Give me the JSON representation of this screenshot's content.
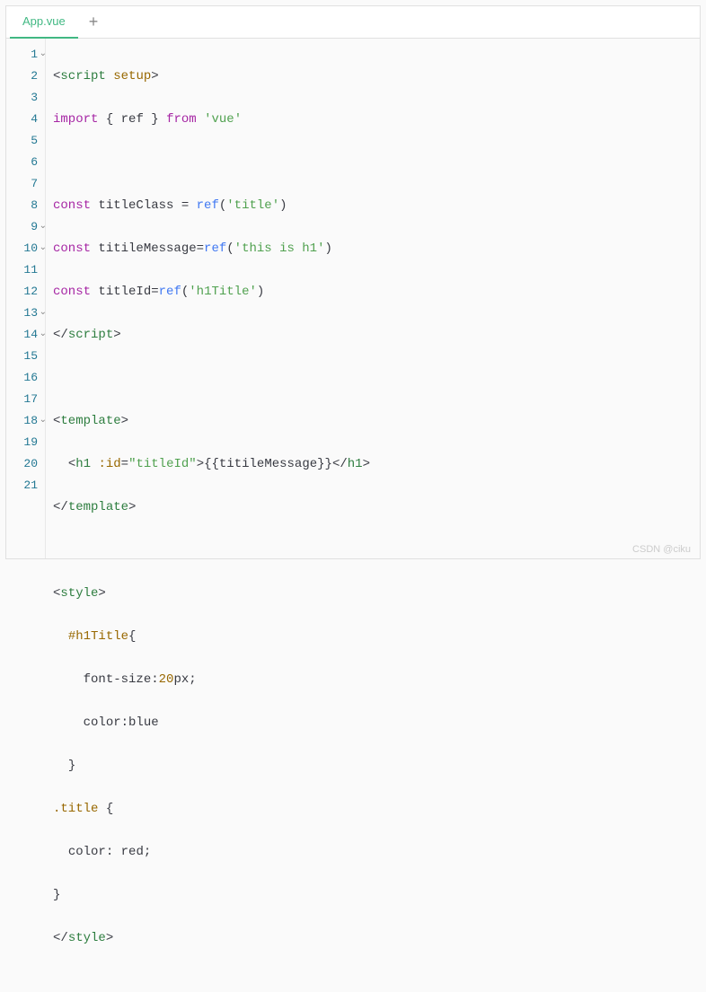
{
  "tabs": {
    "active": "App.vue",
    "add_icon": "+"
  },
  "gutter": {
    "lines": [
      "1",
      "2",
      "3",
      "4",
      "5",
      "6",
      "7",
      "8",
      "9",
      "10",
      "11",
      "12",
      "13",
      "14",
      "15",
      "16",
      "17",
      "18",
      "19",
      "20",
      "21"
    ],
    "foldable": [
      1,
      9,
      10,
      13,
      14,
      18
    ]
  },
  "code": {
    "l1": {
      "open": "<",
      "tag": "script",
      "sp": " ",
      "attr": "setup",
      "close": ">"
    },
    "l2": {
      "kw": "import",
      "sp1": " ",
      "b1": "{ ",
      "id": "ref",
      "b2": " }",
      "sp2": " ",
      "kw2": "from",
      "sp3": " ",
      "str": "'vue'"
    },
    "l3": "",
    "l4": {
      "kw": "const",
      "sp": " ",
      "id": "titleClass",
      "sp2": " ",
      "eq": "=",
      "sp3": " ",
      "fn": "ref",
      "p1": "(",
      "str": "'title'",
      "p2": ")"
    },
    "l5": {
      "kw": "const",
      "sp": " ",
      "id": "titileMessage",
      "eq": "=",
      "fn": "ref",
      "p1": "(",
      "str": "'this is h1'",
      "p2": ")"
    },
    "l6": {
      "kw": "const",
      "sp": " ",
      "id": "titleId",
      "eq": "=",
      "fn": "ref",
      "p1": "(",
      "str": "'h1Title'",
      "p2": ")"
    },
    "l7": {
      "open": "</",
      "tag": "script",
      "close": ">"
    },
    "l8": "",
    "l9": {
      "open": "<",
      "tag": "template",
      "close": ">"
    },
    "l10": {
      "indent": "  ",
      "open": "<",
      "tag": "h1",
      "sp": " ",
      "attr": ":id",
      "eq": "=",
      "q1": "\"",
      "val": "titleId",
      "q2": "\"",
      "close": ">",
      "m1": "{{",
      "mid": "titileMessage",
      "m2": "}}",
      "open2": "</",
      "tag2": "h1",
      "close2": ">"
    },
    "l11": {
      "open": "</",
      "tag": "template",
      "close": ">"
    },
    "l12": "",
    "l13": {
      "open": "<",
      "tag": "style",
      "close": ">"
    },
    "l14": {
      "indent": "  ",
      "sel": "#h1Title",
      "brace": "{"
    },
    "l15": {
      "indent": "    ",
      "prop": "font-size",
      "colon": ":",
      "num": "20",
      "unit": "px",
      "semi": ";"
    },
    "l16": {
      "indent": "    ",
      "prop": "color",
      "colon": ":",
      "val": "blue"
    },
    "l17": {
      "indent": "  ",
      "brace": "}"
    },
    "l18": {
      "sel": ".title",
      "sp": " ",
      "brace": "{"
    },
    "l19": {
      "indent": "  ",
      "prop": "color",
      "colon": ": ",
      "val": "red",
      "semi": ";"
    },
    "l20": {
      "brace": "}"
    },
    "l21": {
      "open": "</",
      "tag": "style",
      "close": ">"
    }
  },
  "watermark": "CSDN @ciku"
}
